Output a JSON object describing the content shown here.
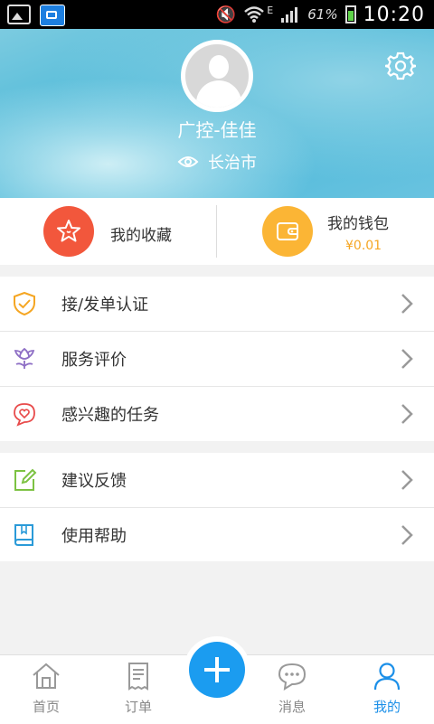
{
  "status_bar": {
    "battery_pct": "61%",
    "time": "10:20",
    "network": "E"
  },
  "profile": {
    "username": "广控-佳佳",
    "city": "长治市"
  },
  "quick_actions": {
    "favorites_label": "我的收藏",
    "wallet_label": "我的钱包",
    "wallet_balance": "¥0.01"
  },
  "menu_group_1": [
    {
      "label": "接/发单认证",
      "icon": "shield-check-icon"
    },
    {
      "label": "服务评价",
      "icon": "tulip-icon"
    },
    {
      "label": "感兴趣的任务",
      "icon": "heart-bubble-icon"
    }
  ],
  "menu_group_2": [
    {
      "label": "建议反馈",
      "icon": "edit-icon"
    },
    {
      "label": "使用帮助",
      "icon": "book-icon"
    }
  ],
  "bottom_nav": [
    {
      "label": "首页",
      "icon": "home-icon"
    },
    {
      "label": "订单",
      "icon": "receipt-icon"
    },
    {
      "label": "消息",
      "icon": "chat-icon"
    },
    {
      "label": "我的",
      "icon": "person-icon",
      "active": true
    }
  ],
  "colors": {
    "accent": "#1b9cf0",
    "favorites": "#f2573c",
    "wallet": "#fbb535",
    "balance": "#f5a623"
  }
}
